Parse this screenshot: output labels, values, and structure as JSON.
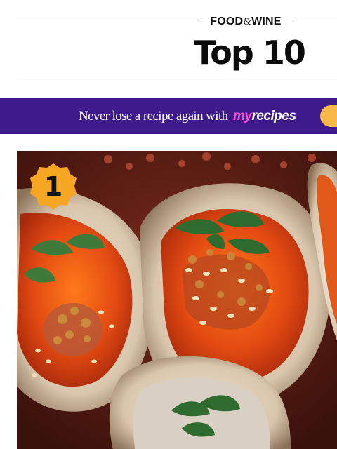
{
  "header": {
    "brand_left": "FOOD",
    "brand_amp": "&",
    "brand_right": "WINE",
    "title": "Top 10"
  },
  "banner": {
    "text": "Never lose a recipe again with",
    "logo_my": "my",
    "logo_recipes": "recipes",
    "background": "#3f1a8c",
    "cta_color": "#f9b84a"
  },
  "hero": {
    "subject": "grilled oysters with chili glaze, breadcrumbs, sesame seeds and mint",
    "rank": "1",
    "badge_color": "#f6a623"
  }
}
